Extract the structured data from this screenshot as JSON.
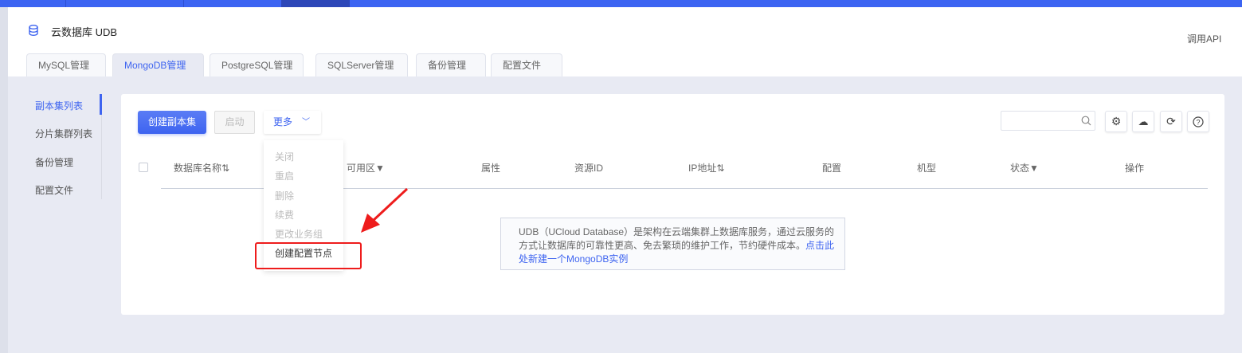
{
  "header": {
    "title": "云数据库 UDB",
    "api_link": "调用API"
  },
  "tabs": [
    "MySQL管理",
    "MongoDB管理",
    "PostgreSQL管理",
    "SQLServer管理",
    "备份管理",
    "配置文件"
  ],
  "sidebar": [
    "副本集列表",
    "分片集群列表",
    "备份管理",
    "配置文件"
  ],
  "toolbar": {
    "create": "创建副本集",
    "start": "启动",
    "more": "更多",
    "search_placeholder": ""
  },
  "more_menu": [
    "关闭",
    "重启",
    "删除",
    "续费",
    "更改业务组",
    "创建配置节点"
  ],
  "columns": [
    "数据库名称⇅",
    "可用区▼",
    "属性",
    "资源ID",
    "IP地址⇅",
    "配置",
    "机型",
    "状态▼",
    "操作"
  ],
  "empty": {
    "text": "UDB（UCloud Database）是架构在云端集群上数据库服务，通过云服务的方式让数据库的可靠性更高、免去繁琐的维护工作，节约硬件成本。",
    "link": "点击此处新建一个MongoDB实例"
  },
  "colors": {
    "primary": "#3e64f0",
    "highlight": "#ee1c1c"
  }
}
